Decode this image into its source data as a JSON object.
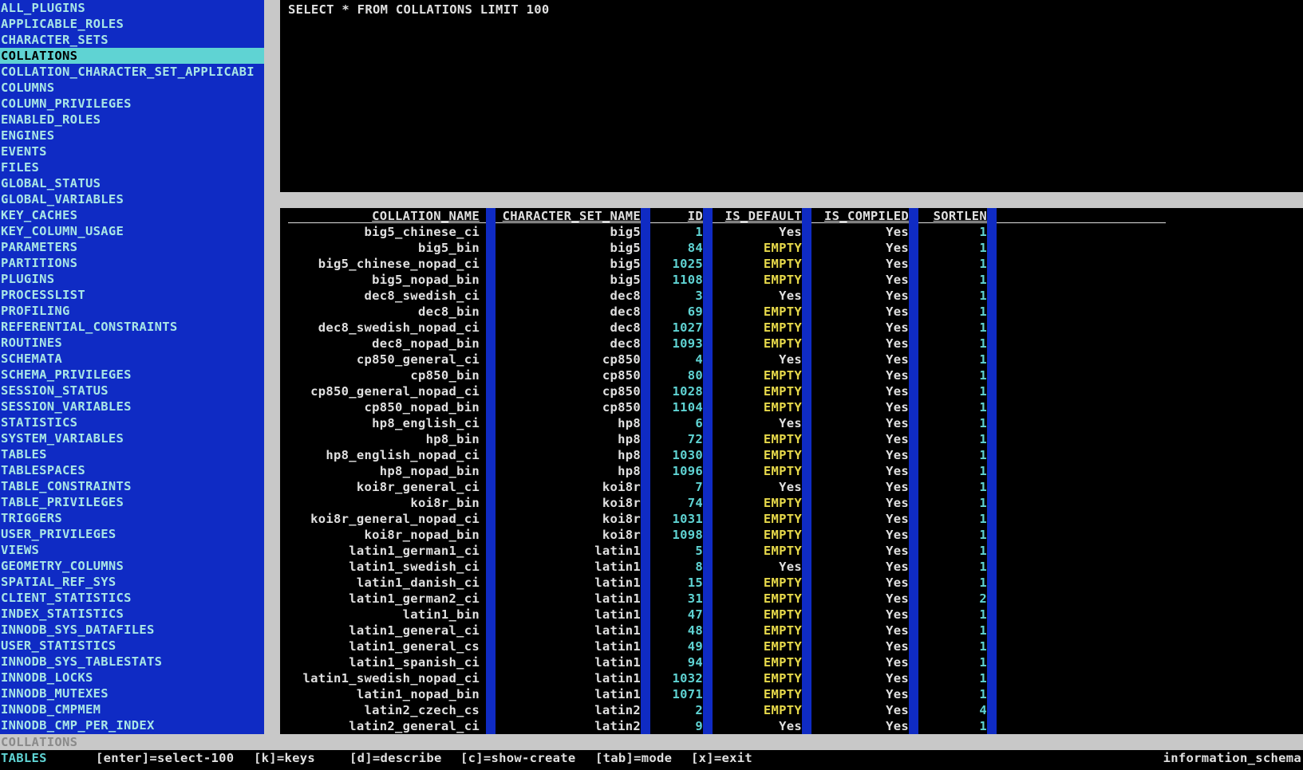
{
  "sidebar": {
    "items": [
      "ALL_PLUGINS",
      "APPLICABLE_ROLES",
      "CHARACTER_SETS",
      "COLLATIONS",
      "COLLATION_CHARACTER_SET_APPLICABI",
      "COLUMNS",
      "COLUMN_PRIVILEGES",
      "ENABLED_ROLES",
      "ENGINES",
      "EVENTS",
      "FILES",
      "GLOBAL_STATUS",
      "GLOBAL_VARIABLES",
      "KEY_CACHES",
      "KEY_COLUMN_USAGE",
      "PARAMETERS",
      "PARTITIONS",
      "PLUGINS",
      "PROCESSLIST",
      "PROFILING",
      "REFERENTIAL_CONSTRAINTS",
      "ROUTINES",
      "SCHEMATA",
      "SCHEMA_PRIVILEGES",
      "SESSION_STATUS",
      "SESSION_VARIABLES",
      "STATISTICS",
      "SYSTEM_VARIABLES",
      "TABLES",
      "TABLESPACES",
      "TABLE_CONSTRAINTS",
      "TABLE_PRIVILEGES",
      "TRIGGERS",
      "USER_PRIVILEGES",
      "VIEWS",
      "GEOMETRY_COLUMNS",
      "SPATIAL_REF_SYS",
      "CLIENT_STATISTICS",
      "INDEX_STATISTICS",
      "INNODB_SYS_DATAFILES",
      "USER_STATISTICS",
      "INNODB_SYS_TABLESTATS",
      "INNODB_LOCKS",
      "INNODB_MUTEXES",
      "INNODB_CMPMEM",
      "INNODB_CMP_PER_INDEX"
    ],
    "selected": "COLLATIONS"
  },
  "query": {
    "text": "SELECT * FROM COLLATIONS LIMIT 100"
  },
  "table": {
    "headers": [
      "COLLATION_NAME",
      "CHARACTER_SET_NAME",
      "ID",
      "IS_DEFAULT",
      "IS_COMPILED",
      "SORTLEN"
    ],
    "rows": [
      [
        "big5_chinese_ci",
        "big5",
        "1",
        "Yes",
        "Yes",
        "1"
      ],
      [
        "big5_bin",
        "big5",
        "84",
        "EMPTY",
        "Yes",
        "1"
      ],
      [
        "big5_chinese_nopad_ci",
        "big5",
        "1025",
        "EMPTY",
        "Yes",
        "1"
      ],
      [
        "big5_nopad_bin",
        "big5",
        "1108",
        "EMPTY",
        "Yes",
        "1"
      ],
      [
        "dec8_swedish_ci",
        "dec8",
        "3",
        "Yes",
        "Yes",
        "1"
      ],
      [
        "dec8_bin",
        "dec8",
        "69",
        "EMPTY",
        "Yes",
        "1"
      ],
      [
        "dec8_swedish_nopad_ci",
        "dec8",
        "1027",
        "EMPTY",
        "Yes",
        "1"
      ],
      [
        "dec8_nopad_bin",
        "dec8",
        "1093",
        "EMPTY",
        "Yes",
        "1"
      ],
      [
        "cp850_general_ci",
        "cp850",
        "4",
        "Yes",
        "Yes",
        "1"
      ],
      [
        "cp850_bin",
        "cp850",
        "80",
        "EMPTY",
        "Yes",
        "1"
      ],
      [
        "cp850_general_nopad_ci",
        "cp850",
        "1028",
        "EMPTY",
        "Yes",
        "1"
      ],
      [
        "cp850_nopad_bin",
        "cp850",
        "1104",
        "EMPTY",
        "Yes",
        "1"
      ],
      [
        "hp8_english_ci",
        "hp8",
        "6",
        "Yes",
        "Yes",
        "1"
      ],
      [
        "hp8_bin",
        "hp8",
        "72",
        "EMPTY",
        "Yes",
        "1"
      ],
      [
        "hp8_english_nopad_ci",
        "hp8",
        "1030",
        "EMPTY",
        "Yes",
        "1"
      ],
      [
        "hp8_nopad_bin",
        "hp8",
        "1096",
        "EMPTY",
        "Yes",
        "1"
      ],
      [
        "koi8r_general_ci",
        "koi8r",
        "7",
        "Yes",
        "Yes",
        "1"
      ],
      [
        "koi8r_bin",
        "koi8r",
        "74",
        "EMPTY",
        "Yes",
        "1"
      ],
      [
        "koi8r_general_nopad_ci",
        "koi8r",
        "1031",
        "EMPTY",
        "Yes",
        "1"
      ],
      [
        "koi8r_nopad_bin",
        "koi8r",
        "1098",
        "EMPTY",
        "Yes",
        "1"
      ],
      [
        "latin1_german1_ci",
        "latin1",
        "5",
        "EMPTY",
        "Yes",
        "1"
      ],
      [
        "latin1_swedish_ci",
        "latin1",
        "8",
        "Yes",
        "Yes",
        "1"
      ],
      [
        "latin1_danish_ci",
        "latin1",
        "15",
        "EMPTY",
        "Yes",
        "1"
      ],
      [
        "latin1_german2_ci",
        "latin1",
        "31",
        "EMPTY",
        "Yes",
        "2"
      ],
      [
        "latin1_bin",
        "latin1",
        "47",
        "EMPTY",
        "Yes",
        "1"
      ],
      [
        "latin1_general_ci",
        "latin1",
        "48",
        "EMPTY",
        "Yes",
        "1"
      ],
      [
        "latin1_general_cs",
        "latin1",
        "49",
        "EMPTY",
        "Yes",
        "1"
      ],
      [
        "latin1_spanish_ci",
        "latin1",
        "94",
        "EMPTY",
        "Yes",
        "1"
      ],
      [
        "latin1_swedish_nopad_ci",
        "latin1",
        "1032",
        "EMPTY",
        "Yes",
        "1"
      ],
      [
        "latin1_nopad_bin",
        "latin1",
        "1071",
        "EMPTY",
        "Yes",
        "1"
      ],
      [
        "latin2_czech_cs",
        "latin2",
        "2",
        "EMPTY",
        "Yes",
        "4"
      ],
      [
        "latin2_general_ci",
        "latin2",
        "9",
        "Yes",
        "Yes",
        "1"
      ]
    ]
  },
  "status": {
    "text": "COLLATIONS"
  },
  "footer": {
    "mode": "TABLES",
    "keys": [
      "[enter]=select-100",
      "[k]=keys",
      "[d]=describe",
      "[c]=show-create",
      "[tab]=mode",
      "[x]=exit"
    ],
    "database": "information_schema"
  },
  "colors": {
    "panel_blue": "#0f2bc4",
    "selection": "#5fd3d3",
    "empty_value": "#e6d84a",
    "number": "#5fd3d3"
  }
}
